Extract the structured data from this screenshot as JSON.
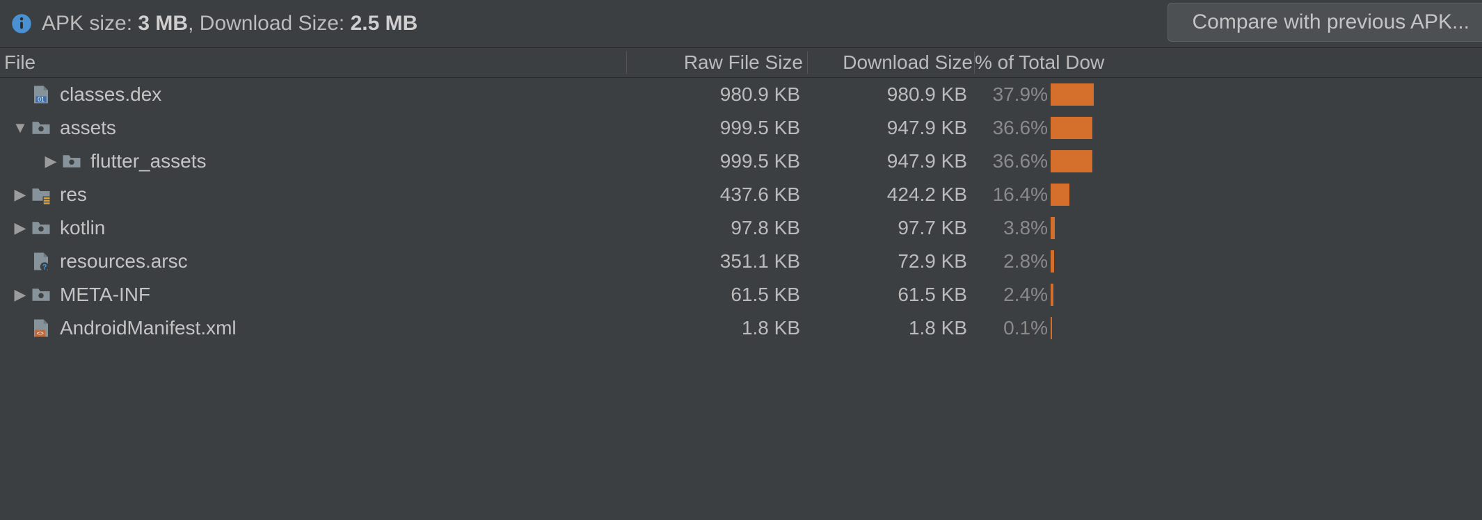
{
  "info": {
    "apk_size_label": "APK size:",
    "apk_size_value": "3 MB",
    "separator": ",",
    "dl_size_label": "Download Size:",
    "dl_size_value": "2.5 MB"
  },
  "compare_button_label": "Compare with previous APK...",
  "columns": {
    "file": "File",
    "raw": "Raw File Size",
    "download": "Download Size",
    "pct": "% of Total Dow"
  },
  "colors": {
    "bar": "#d56f2c"
  },
  "max_pct": 37.9,
  "rows": [
    {
      "depth": 0,
      "arrow": "",
      "icon": "dex",
      "name": "classes.dex",
      "raw": "980.9 KB",
      "dl": "980.9 KB",
      "pct": "37.9%",
      "pctnum": 37.9
    },
    {
      "depth": 0,
      "arrow": "down",
      "icon": "folder",
      "name": "assets",
      "raw": "999.5 KB",
      "dl": "947.9 KB",
      "pct": "36.6%",
      "pctnum": 36.6
    },
    {
      "depth": 1,
      "arrow": "right",
      "icon": "folder",
      "name": "flutter_assets",
      "raw": "999.5 KB",
      "dl": "947.9 KB",
      "pct": "36.6%",
      "pctnum": 36.6
    },
    {
      "depth": 0,
      "arrow": "right",
      "icon": "resfolder",
      "name": "res",
      "raw": "437.6 KB",
      "dl": "424.2 KB",
      "pct": "16.4%",
      "pctnum": 16.4
    },
    {
      "depth": 0,
      "arrow": "right",
      "icon": "folder",
      "name": "kotlin",
      "raw": "97.8 KB",
      "dl": "97.7 KB",
      "pct": "3.8%",
      "pctnum": 3.8
    },
    {
      "depth": 0,
      "arrow": "",
      "icon": "arsc",
      "name": "resources.arsc",
      "raw": "351.1 KB",
      "dl": "72.9 KB",
      "pct": "2.8%",
      "pctnum": 2.8
    },
    {
      "depth": 0,
      "arrow": "right",
      "icon": "folder",
      "name": "META-INF",
      "raw": "61.5 KB",
      "dl": "61.5 KB",
      "pct": "2.4%",
      "pctnum": 2.4
    },
    {
      "depth": 0,
      "arrow": "",
      "icon": "xml",
      "name": "AndroidManifest.xml",
      "raw": "1.8 KB",
      "dl": "1.8 KB",
      "pct": "0.1%",
      "pctnum": 0.1
    }
  ]
}
